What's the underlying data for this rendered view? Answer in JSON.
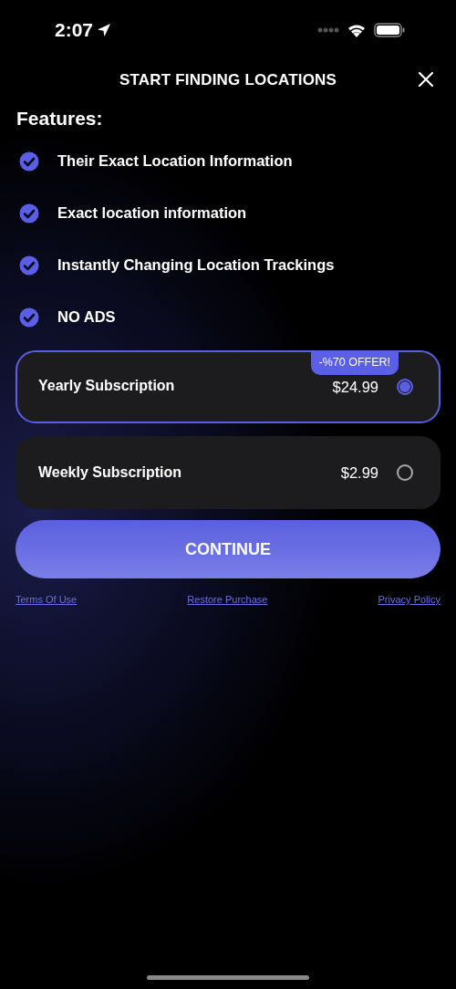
{
  "status_bar": {
    "time": "2:07"
  },
  "header": {
    "title": "START FINDING LOCATIONS"
  },
  "features_title": "Features:",
  "features": [
    "Their Exact Location Information",
    "Exact location information",
    "Instantly Changing Location Trackings",
    "NO ADS"
  ],
  "plans": [
    {
      "name": "Yearly Subscription",
      "price": "$24.99",
      "badge": "-%70 OFFER!",
      "selected": true
    },
    {
      "name": "Weekly Subscription",
      "price": "$2.99",
      "selected": false
    }
  ],
  "continue_button": "CONTINUE",
  "links": [
    "Terms Of Use",
    "Restore Purchase",
    "Privacy Policy"
  ]
}
